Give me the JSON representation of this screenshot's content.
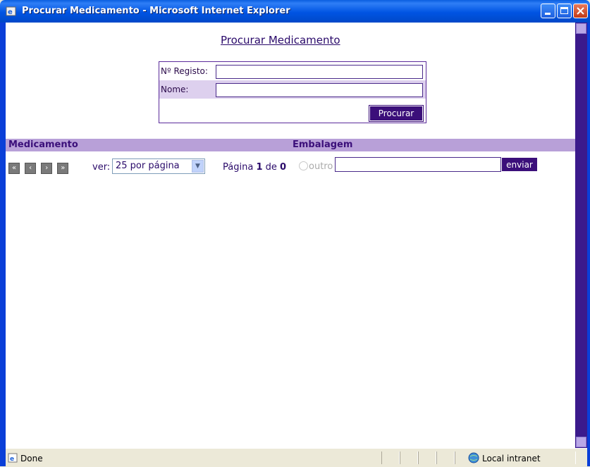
{
  "window": {
    "title": "Procurar Medicamento - Microsoft Internet Explorer"
  },
  "page": {
    "title": "Procurar Medicamento",
    "search": {
      "registo_label": "Nº Registo:",
      "registo_value": "",
      "nome_label": "Nome:",
      "nome_value": "",
      "button_label": "Procurar"
    },
    "results_header": {
      "col1": "Medicamento",
      "col2": "Embalagem"
    },
    "pager": {
      "ver_label": "ver:",
      "per_page_selected": "25 por página",
      "pagina_label": "Página",
      "current_page": "1",
      "de_label": "de",
      "total_pages": "0",
      "nav_icons": [
        "first-page-icon",
        "prev-page-icon",
        "next-page-icon",
        "last-page-icon"
      ]
    },
    "outro": {
      "label": "outro",
      "value": "",
      "button_label": "enviar"
    }
  },
  "statusbar": {
    "status": "Done",
    "zone": "Local intranet"
  },
  "colors": {
    "accent": "#3b0f7a",
    "header_bg": "#b8a0d8",
    "titlebar": "#0054e3"
  }
}
